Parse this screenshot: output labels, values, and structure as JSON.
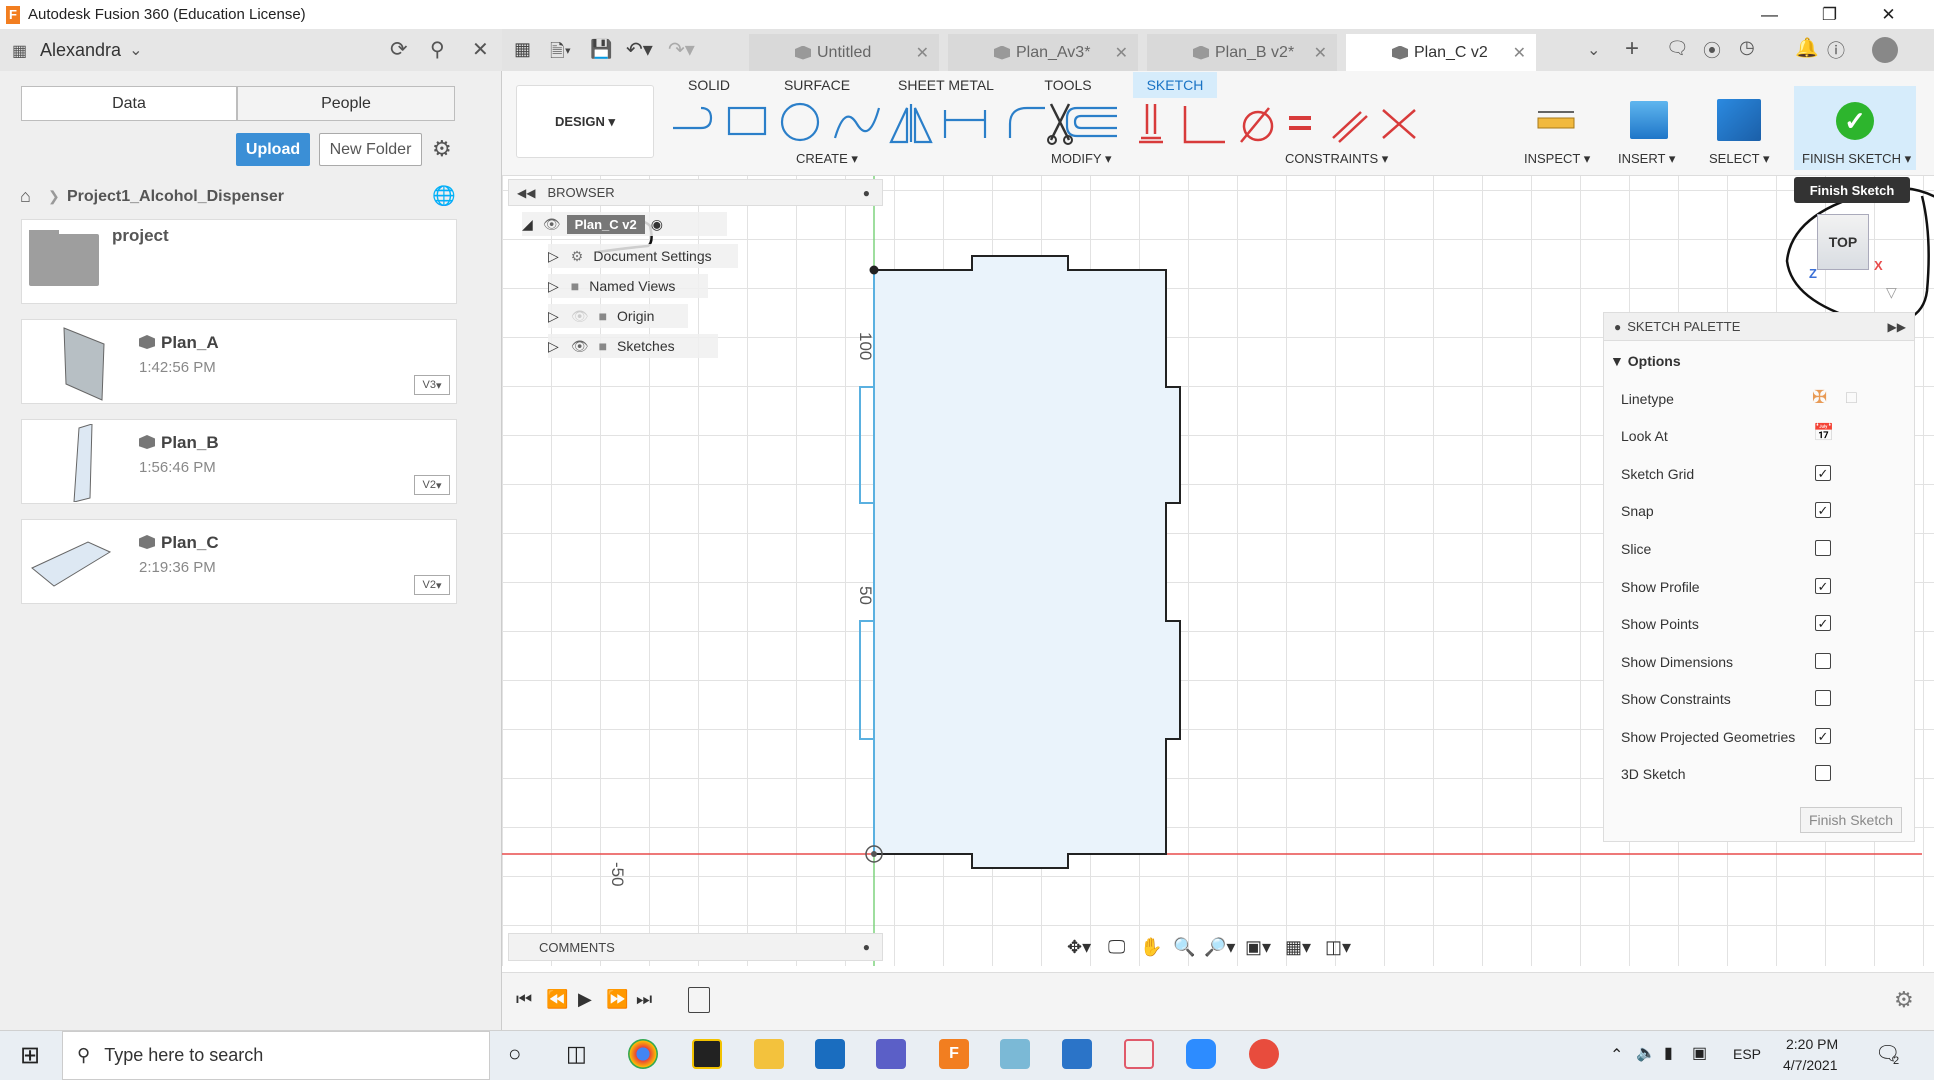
{
  "window": {
    "title": "Autodesk Fusion 360 (Education License)",
    "logo_letter": "F"
  },
  "data_panel": {
    "user": "Alexandra",
    "tabs": [
      "Data",
      "People"
    ],
    "upload_label": "Upload",
    "new_folder_label": "New Folder",
    "breadcrumb": "Project1_Alcohol_Dispenser",
    "folder": {
      "name": "project"
    },
    "files": [
      {
        "name": "Plan_A",
        "time": "1:42:56 PM",
        "version": "V3"
      },
      {
        "name": "Plan_B",
        "time": "1:56:46 PM",
        "version": "V2"
      },
      {
        "name": "Plan_C",
        "time": "2:19:36 PM",
        "version": "V2"
      }
    ]
  },
  "doc_tabs": [
    {
      "label": "Untitled",
      "active": false
    },
    {
      "label": "Plan_Av3*",
      "active": false
    },
    {
      "label": "Plan_B v2*",
      "active": false
    },
    {
      "label": "Plan_C v2",
      "active": true
    }
  ],
  "ribbon": {
    "workspace": "DESIGN",
    "tabs": [
      "SOLID",
      "SURFACE",
      "SHEET METAL",
      "TOOLS",
      "SKETCH"
    ],
    "active_tab": "SKETCH",
    "groups": {
      "create": "CREATE",
      "modify": "MODIFY",
      "constraints": "CONSTRAINTS",
      "inspect": "INSPECT",
      "insert": "INSERT",
      "select": "SELECT",
      "finish": "FINISH SKETCH"
    },
    "tooltip": "Finish Sketch"
  },
  "browser": {
    "header": "BROWSER",
    "root": "Plan_C v2",
    "items": [
      "Document Settings",
      "Named Views",
      "Origin",
      "Sketches"
    ]
  },
  "viewcube": {
    "face": "TOP",
    "x_axis": "X",
    "z_axis": "Z"
  },
  "canvas_labels": {
    "dim_100": "100",
    "dim_50": "50",
    "dim_neg50": "-50"
  },
  "comments": {
    "header": "COMMENTS"
  },
  "palette": {
    "header": "SKETCH PALETTE",
    "section": "Options",
    "rows": [
      {
        "label": "Linetype"
      },
      {
        "label": "Look At"
      },
      {
        "label": "Sketch Grid",
        "checked": true
      },
      {
        "label": "Snap",
        "checked": true
      },
      {
        "label": "Slice",
        "checked": false
      },
      {
        "label": "Show Profile",
        "checked": true
      },
      {
        "label": "Show Points",
        "checked": true
      },
      {
        "label": "Show Dimensions",
        "checked": false
      },
      {
        "label": "Show Constraints",
        "checked": false
      },
      {
        "label": "Show Projected Geometries",
        "checked": true
      },
      {
        "label": "3D Sketch",
        "checked": false
      }
    ],
    "finish_button": "Finish Sketch"
  },
  "taskbar": {
    "search_placeholder": "Type here to search",
    "lang": "ESP",
    "time": "2:20 PM",
    "date": "4/7/2021",
    "notif_count": "2"
  },
  "colors": {
    "accent": "#3b8fd6",
    "sketch_fill": "#eaf3fb",
    "finish_green": "#2db52d",
    "axis_red": "#e84c4c",
    "axis_green": "#7ed37e"
  }
}
